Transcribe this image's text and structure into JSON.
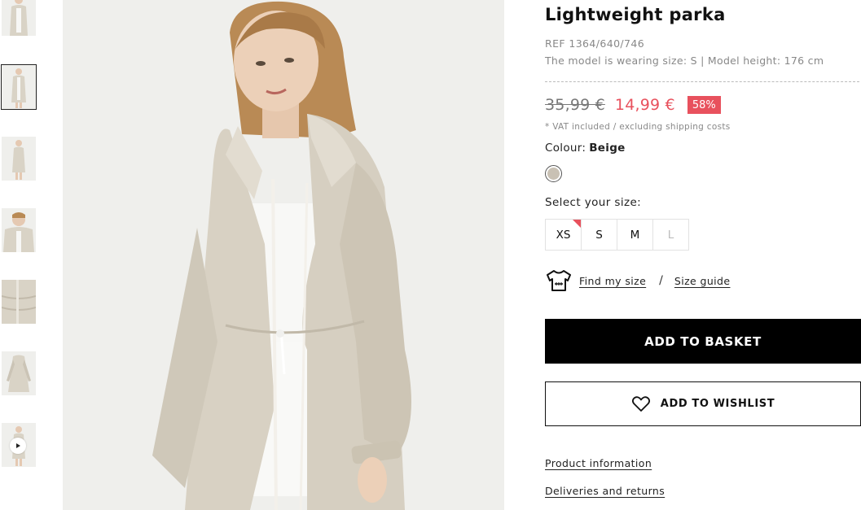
{
  "product": {
    "title": "Lightweight parka",
    "ref": "REF 1364/640/746",
    "model_info": "The model is wearing size: S | Model height: 176 cm",
    "old_price": "35,99 €",
    "new_price": "14,99 €",
    "discount": "58%",
    "vat_note": "* VAT included / excluding shipping costs",
    "colour_label": "Colour:",
    "colour_value": "Beige",
    "swatch_color": "#c9c1b4",
    "size_label": "Select your size:",
    "sizes": [
      {
        "label": "XS",
        "available": true,
        "low_stock": true
      },
      {
        "label": "S",
        "available": true,
        "low_stock": false
      },
      {
        "label": "M",
        "available": true,
        "low_stock": false
      },
      {
        "label": "L",
        "available": false,
        "low_stock": false
      }
    ],
    "find_size": "Find my size",
    "slash": "/",
    "size_guide": "Size guide",
    "add_to_basket": "ADD TO BASKET",
    "add_to_wishlist": "ADD TO WISHLIST",
    "product_information": "Product information",
    "deliveries_returns": "Deliveries and returns"
  },
  "gallery": {
    "thumbnails": [
      "front",
      "front-full",
      "side-full",
      "close-up",
      "detail",
      "flat",
      "video"
    ],
    "selected_index": 1,
    "video_thumbnail_index": 6
  },
  "colors": {
    "accent": "#e8515d",
    "button_dark": "#000000",
    "muted_text": "#888888",
    "parka_beige": "#d9d3c6"
  },
  "icons": [
    "play-icon",
    "tshirt-icon",
    "heart-icon"
  ]
}
